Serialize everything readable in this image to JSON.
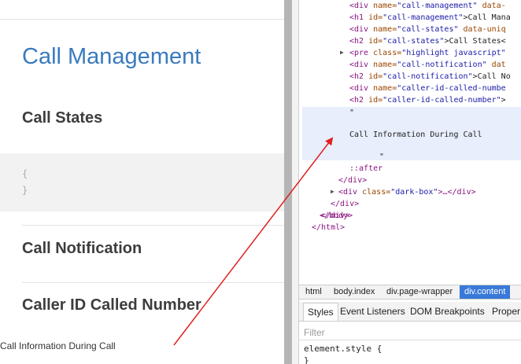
{
  "page": {
    "title": "Call Management",
    "sections": [
      "Call States",
      "Call Notification",
      "Caller ID Called Number"
    ],
    "code_lines": [
      "{",
      "}"
    ],
    "body_text": "Call Information During Call"
  },
  "devtools": {
    "dom_lines": [
      {
        "tag_open": "<div ",
        "attr": "name=",
        "value": "\"call-management\"",
        "rest": " data-"
      },
      {
        "tag_open": "<h1 ",
        "attr": "id=",
        "value": "\"call-management\"",
        "rest": ">Call Mana"
      },
      {
        "tag_open": "<div ",
        "attr": "name=",
        "value": "\"call-states\"",
        "rest": " data-uniq"
      },
      {
        "tag_open": "<h2 ",
        "attr": "id=",
        "value": "\"call-states\"",
        "rest": ">Call States<"
      },
      {
        "tag_open": "<pre ",
        "attr": "class=",
        "value": "\"highlight javascript\"",
        "rest": ""
      },
      {
        "tag_open": "<div ",
        "attr": "name=",
        "value": "\"call-notification\"",
        "rest": " dat"
      },
      {
        "tag_open": "<h2 ",
        "attr": "id=",
        "value": "\"call-notification\"",
        "rest": ">Call No"
      },
      {
        "tag_open": "<div ",
        "attr": "name=",
        "value": "\"caller-id-called-numbe",
        "rest": ""
      },
      {
        "tag_open": "<h2 ",
        "attr": "id=",
        "value": "\"caller-id-called-number\"",
        "rest": ">"
      }
    ],
    "text_node": "Call Information During Call",
    "quote_open": "\"",
    "quote_close": "\"",
    "after": "::after",
    "close_div1": "</div>",
    "dark_box": {
      "tag_open": "<div ",
      "attr": "class=",
      "value": "\"dark-box\"",
      "rest": ">…</div>"
    },
    "close_div2": "</div>",
    "close_div3": "</div>",
    "close_body": "</body>",
    "close_html": "</html>",
    "breadcrumbs": [
      "html",
      "body.index",
      "div.page-wrapper",
      "div.content"
    ],
    "tabs": [
      "Styles",
      "Event Listeners",
      "DOM Breakpoints",
      "Proper"
    ],
    "filter_placeholder": "Filter",
    "element_style": "element.style {",
    "element_style_close": "}"
  },
  "colors": {
    "accent": "#3a7abf",
    "selection": "#3879d9",
    "annotation_arrow": "#e02020"
  }
}
